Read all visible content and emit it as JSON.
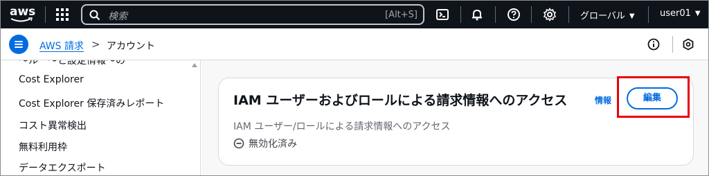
{
  "topbar": {
    "logo_text": "aws",
    "search_placeholder": "検索",
    "search_shortcut": "[Alt+S]",
    "region_label": "グローバル",
    "user_label": "user01"
  },
  "breadcrumb": {
    "service_link": "AWS 請求",
    "separator": ">",
    "current": "アカウント"
  },
  "sidebar": {
    "partial_item": "〜ルー〜と設定情報〜の",
    "items": [
      {
        "label": "Cost Explorer"
      },
      {
        "label": "Cost Explorer 保存済みレポート"
      },
      {
        "label": "コスト異常検出"
      },
      {
        "label": "無料利用枠"
      },
      {
        "label": "データエクスポート"
      }
    ]
  },
  "panel": {
    "title": "IAM ユーザーおよびロールによる請求情報へのアクセス",
    "info_link": "情報",
    "edit_button": "編集",
    "description": "IAM ユーザー/ロールによる請求情報へのアクセス",
    "status": "無効化済み"
  },
  "colors": {
    "topbar_bg": "#0f141a",
    "link_blue": "#006ce0",
    "highlight_red": "#e8000b"
  }
}
